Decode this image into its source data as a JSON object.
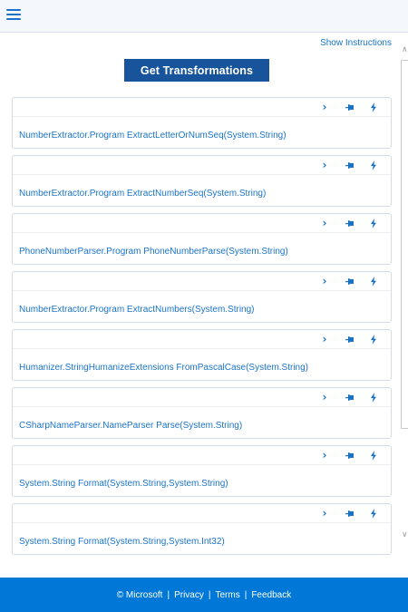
{
  "header": {
    "menu_icon": "hamburger-menu-icon"
  },
  "links": {
    "show_instructions": "Show Instructions"
  },
  "main": {
    "button_label": "Get Transformations"
  },
  "cards": [
    {
      "text": "NumberExtractor.Program ExtractLetterOrNumSeq(System.String)"
    },
    {
      "text": "NumberExtractor.Program ExtractNumberSeq(System.String)"
    },
    {
      "text": "PhoneNumberParser.Program PhoneNumberParse(System.String)"
    },
    {
      "text": "NumberExtractor.Program ExtractNumbers(System.String)"
    },
    {
      "text": "Humanizer.StringHumanizeExtensions FromPascalCase(System.String)"
    },
    {
      "text": "CSharpNameParser.NameParser Parse(System.String)"
    },
    {
      "text": "System.String Format(System.String,System.String)"
    },
    {
      "text": "System.String Format(System.String,System.Int32)"
    }
  ],
  "card_icons": [
    "chevron-right-icon",
    "pin-icon",
    "lightning-icon"
  ],
  "footer": {
    "copyright": "© Microsoft",
    "privacy": "Privacy",
    "terms": "Terms",
    "feedback": "Feedback",
    "separator": "|"
  },
  "colors": {
    "accent": "#1a73c9",
    "button": "#17549c",
    "footer": "#0078d7"
  }
}
